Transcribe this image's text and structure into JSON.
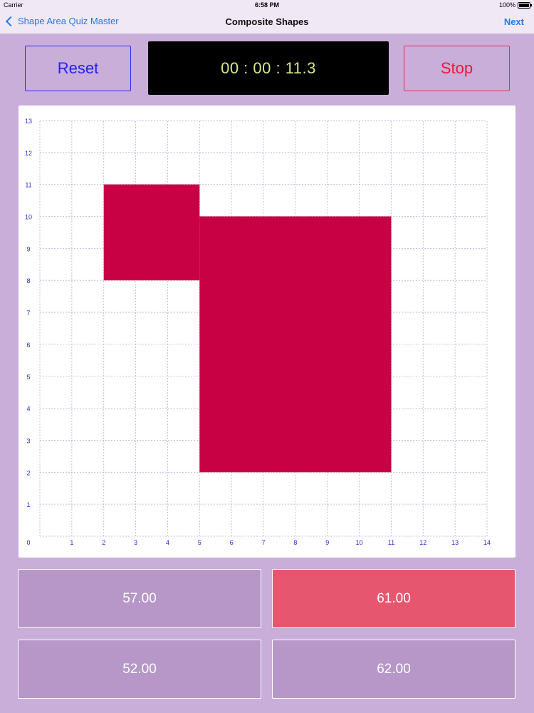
{
  "status_bar": {
    "carrier": "Carrier",
    "time": "6:58 PM",
    "battery": "100%"
  },
  "nav": {
    "back_label": "Shape Area Quiz Master",
    "title": "Composite Shapes",
    "next_label": "Next"
  },
  "controls": {
    "reset_label": "Reset",
    "timer": "00 : 00 : 11.3",
    "stop_label": "Stop"
  },
  "grid": {
    "x_max": 14,
    "y_max": 13,
    "x_ticks": [
      "0",
      "1",
      "2",
      "3",
      "4",
      "5",
      "6",
      "7",
      "8",
      "9",
      "10",
      "11",
      "12",
      "13",
      "14"
    ],
    "y_ticks": [
      "1",
      "2",
      "3",
      "4",
      "5",
      "6",
      "7",
      "8",
      "9",
      "10",
      "11",
      "12",
      "13"
    ],
    "shape_color": "#c80044",
    "grid_color": "#b8b0e0",
    "tick_color": "#2a2ad0",
    "shape_rects": [
      {
        "x1": 2,
        "y1": 8,
        "x2": 5,
        "y2": 11
      },
      {
        "x1": 5,
        "y1": 2,
        "x2": 11,
        "y2": 10
      }
    ]
  },
  "answers": [
    {
      "label": "57.00",
      "state": "default"
    },
    {
      "label": "61.00",
      "state": "wrong"
    },
    {
      "label": "52.00",
      "state": "default"
    },
    {
      "label": "62.00",
      "state": "default"
    }
  ]
}
